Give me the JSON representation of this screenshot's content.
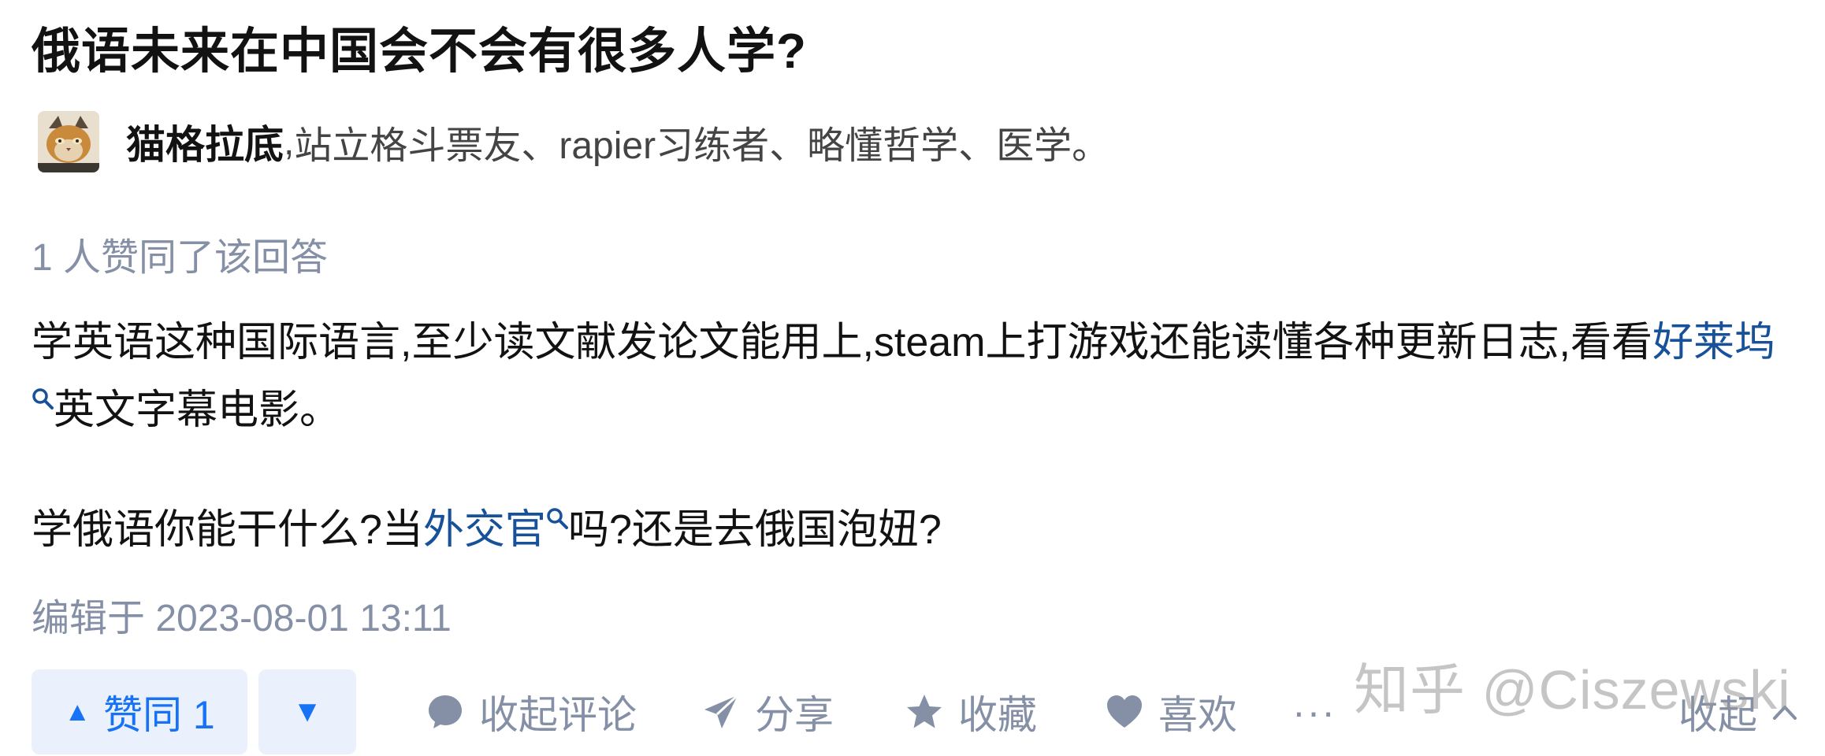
{
  "question": {
    "title": "俄语未来在中国会不会有很多人学?"
  },
  "author": {
    "name": "猫格拉底",
    "separator": ",",
    "bio": "站立格斗票友、rapier习练者、略懂哲学、医学。"
  },
  "answer": {
    "votes_hint": "1 人赞同了该回答",
    "paragraph1": {
      "part1": "学英语这种国际语言,至少读文献发论文能用上,steam上打游戏还能读懂各种更新日志,看看",
      "link": "好莱坞",
      "part2": "英文字幕电影。"
    },
    "paragraph2": {
      "part1": "学俄语你能干什么?当",
      "link": "外交官",
      "part2": "吗?还是去俄国泡妞?"
    },
    "edited": "编辑于 2023-08-01 13:11"
  },
  "actions": {
    "upvote_label": "赞同 1",
    "upvote_icon": "triangle-up",
    "downvote_icon": "triangle-down",
    "comment_label": "收起评论",
    "share_label": "分享",
    "favorite_label": "收藏",
    "like_label": "喜欢",
    "more_label": "···",
    "collapse_label": "收起"
  },
  "watermark": "知乎 @Ciszewski",
  "colors": {
    "primary_blue": "#1772f6",
    "link_blue": "#175199",
    "muted_gray": "#8590a6",
    "button_bg": "#eaf1fc",
    "text": "#121212"
  }
}
